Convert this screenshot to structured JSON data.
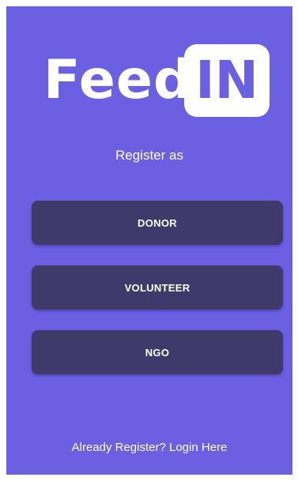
{
  "brand": {
    "logo_left": "Feed",
    "logo_right": "IN"
  },
  "register": {
    "title": "Register as",
    "buttons": [
      "DONOR",
      "VOLUNTEER",
      "NGO"
    ]
  },
  "footer": {
    "login_link": "Already Register? Login Here"
  },
  "colors": {
    "background": "#6b5fe2",
    "button": "#40396b",
    "text": "#ffffff"
  }
}
